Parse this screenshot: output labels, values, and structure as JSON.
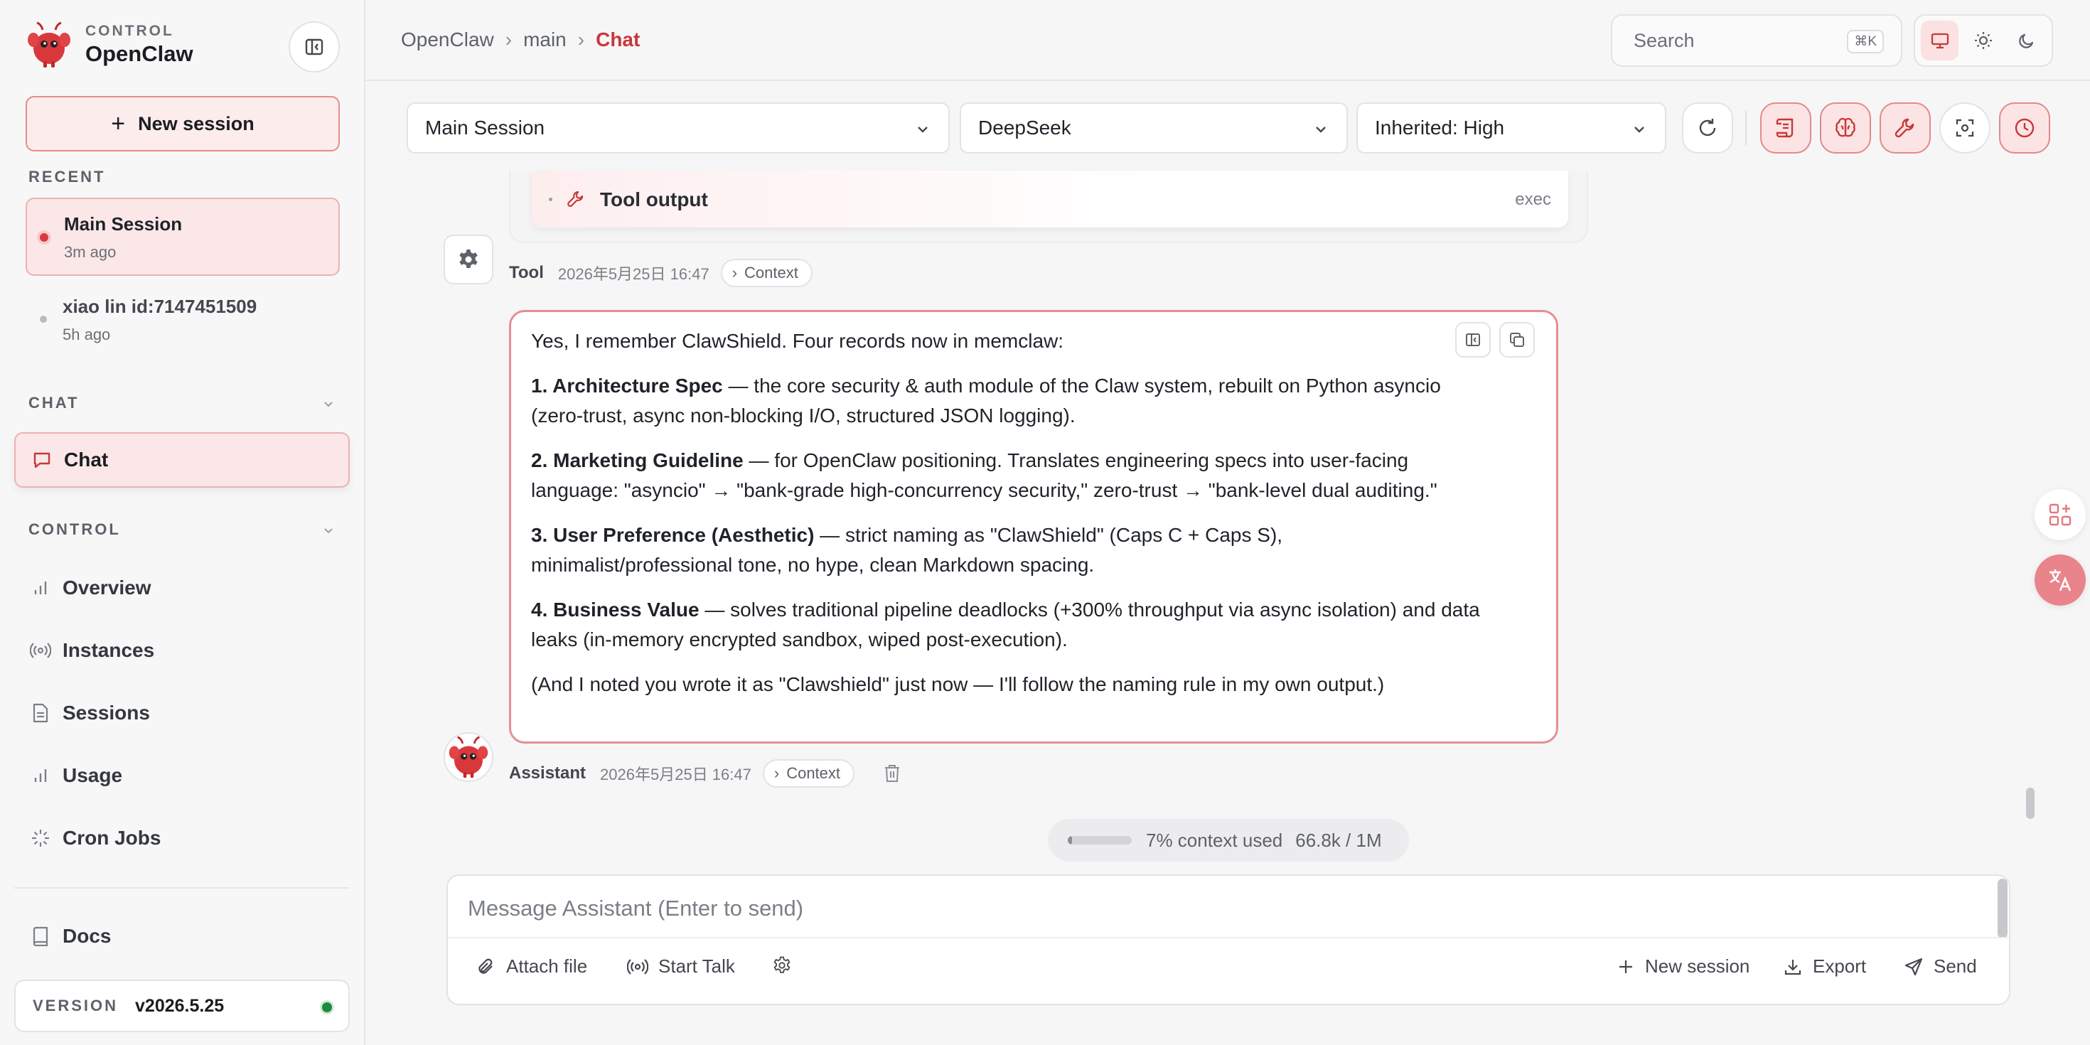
{
  "sidebar": {
    "brand_sub": "CONTROL",
    "brand_title": "OpenClaw",
    "new_session_label": "New session",
    "recent_label": "RECENT",
    "sessions": [
      {
        "title": "Main Session",
        "time": "3m ago"
      },
      {
        "title": "xiao lin id:7147451509",
        "time": "5h ago"
      }
    ],
    "chat_section_label": "CHAT",
    "chat_item_label": "Chat",
    "control_section_label": "CONTROL",
    "control_items": [
      {
        "label": "Overview",
        "icon": "bar-chart-icon"
      },
      {
        "label": "Instances",
        "icon": "broadcast-icon"
      },
      {
        "label": "Sessions",
        "icon": "document-icon"
      },
      {
        "label": "Usage",
        "icon": "bar-chart-icon"
      },
      {
        "label": "Cron Jobs",
        "icon": "loader-icon"
      }
    ],
    "docs_label": "Docs",
    "version_label": "VERSION",
    "version_value": "v2026.5.25"
  },
  "topbar": {
    "breadcrumb": [
      "OpenClaw",
      "main",
      "Chat"
    ],
    "search_placeholder": "Search",
    "search_shortcut": "⌘K"
  },
  "toolbar": {
    "session_select": "Main Session",
    "model_select": "DeepSeek",
    "thinking_select": "Inherited: High"
  },
  "chat": {
    "tool_output_label": "Tool output",
    "tool_output_kind": "exec",
    "tool_role": "Tool",
    "tool_time": "2026年5月25日 16:47",
    "context_label": "Context",
    "assistant_role": "Assistant",
    "assistant_time": "2026年5月25日 16:47",
    "message": {
      "intro": "Yes, I remember ClawShield. Four records now in memclaw:",
      "items": [
        {
          "title": "1. Architecture Spec",
          "text": " — the core security & auth module of the Claw system, rebuilt on Python asyncio (zero-trust, async non-blocking I/O, structured JSON logging)."
        },
        {
          "title": "2. Marketing Guideline",
          "text": " — for OpenClaw positioning. Translates engineering specs into user-facing language: \"asyncio\" → \"bank-grade high-concurrency security,\" zero-trust → \"bank-level dual auditing.\""
        },
        {
          "title": "3. User Preference (Aesthetic)",
          "text": " — strict naming as \"ClawShield\" (Caps C + Caps S), minimalist/professional tone, no hype, clean Markdown spacing."
        },
        {
          "title": "4. Business Value",
          "text": " — solves traditional pipeline deadlocks (+300% throughput via async isolation) and data leaks (in-memory encrypted sandbox, wiped post-execution)."
        }
      ],
      "outro": "(And I noted you wrote it as \"Clawshield\" just now — I'll follow the naming rule in my own output.)"
    },
    "context_usage_text": "7% context used",
    "context_usage_amount": "66.8k / 1M",
    "context_usage_fraction": 0.07
  },
  "composer": {
    "placeholder": "Message Assistant (Enter to send)",
    "attach_label": "Attach file",
    "talk_label": "Start Talk",
    "new_session_label": "New session",
    "export_label": "Export",
    "send_label": "Send"
  },
  "colors": {
    "accent": "#c8373a",
    "accent_soft": "#fbe7e7",
    "status_online": "#1e8a3c"
  }
}
